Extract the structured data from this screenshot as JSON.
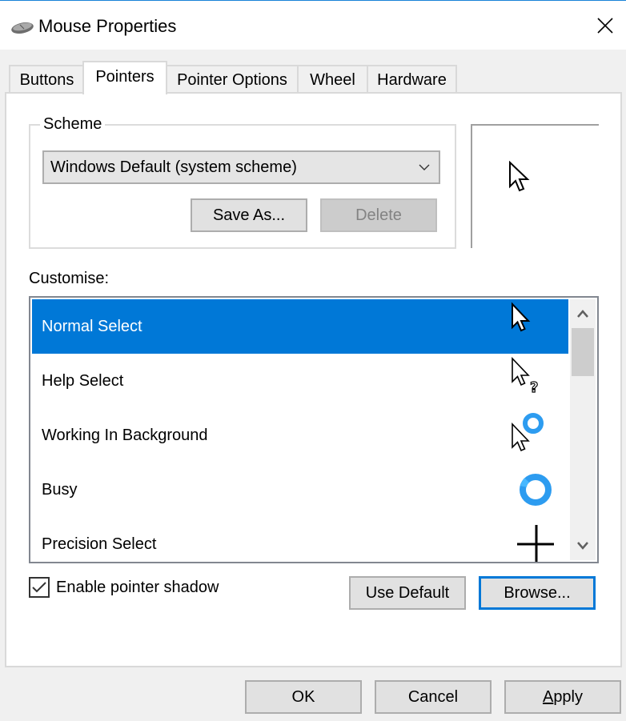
{
  "window": {
    "title": "Mouse Properties",
    "icon": "mouse-icon",
    "close_icon": "close-icon"
  },
  "tabs": [
    {
      "label": "Buttons",
      "active": false
    },
    {
      "label": "Pointers",
      "active": true
    },
    {
      "label": "Pointer Options",
      "active": false
    },
    {
      "label": "Wheel",
      "active": false
    },
    {
      "label": "Hardware",
      "active": false
    }
  ],
  "scheme": {
    "group_label": "Scheme",
    "selected": "Windows Default (system scheme)",
    "save_as_label": "Save As...",
    "delete_label": "Delete",
    "delete_enabled": false
  },
  "preview": {
    "cursor": "arrow-cursor-icon"
  },
  "customise": {
    "label": "Customise:",
    "items": [
      {
        "label": "Normal Select",
        "icon": "arrow-cursor-icon",
        "selected": true
      },
      {
        "label": "Help Select",
        "icon": "help-cursor-icon",
        "selected": false
      },
      {
        "label": "Working In Background",
        "icon": "working-cursor-icon",
        "selected": false
      },
      {
        "label": "Busy",
        "icon": "busy-cursor-icon",
        "selected": false
      },
      {
        "label": "Precision Select",
        "icon": "crosshair-cursor-icon",
        "selected": false
      }
    ]
  },
  "pointer_shadow": {
    "label": "Enable pointer shadow",
    "checked": true
  },
  "use_default_label": "Use Default",
  "browse_label": "Browse...",
  "footer": {
    "ok_label": "OK",
    "cancel_label": "Cancel",
    "apply_label": "Apply",
    "apply_mnemonic": "A",
    "apply_rest": "pply"
  },
  "colors": {
    "accent": "#0078d7",
    "busy_ring": "#2d9cf0",
    "window_bg": "#f0f0f0"
  }
}
